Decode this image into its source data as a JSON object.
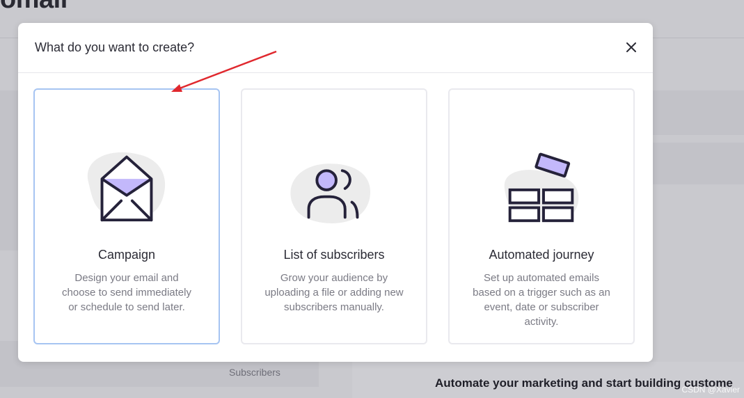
{
  "background": {
    "page_title_fragment": "omail",
    "subscribers_label": "Subscribers",
    "automate_text": "Automate your marketing and start building custome"
  },
  "modal": {
    "title": "What do you want to create?",
    "close_icon": "close-icon",
    "cards": [
      {
        "title": "Campaign",
        "description": "Design your email and choose to send immediately or schedule to send later.",
        "icon": "envelope-icon",
        "selected": true
      },
      {
        "title": "List of subscribers",
        "description": "Grow your audience by uploading a file or adding new subscribers manually.",
        "icon": "people-icon",
        "selected": false
      },
      {
        "title": "Automated journey",
        "description": "Set up automated emails based on a trigger such as an event, date or subscriber activity.",
        "icon": "workflow-blocks-icon",
        "selected": false
      }
    ]
  },
  "annotation": {
    "arrow_color": "#e0282e"
  },
  "watermark": "CSDN @Xavier",
  "colors": {
    "accent_purple": "#c3b8fb",
    "selected_border": "#a6c4f2",
    "blob_gray": "#ececec",
    "icon_stroke": "#25223a"
  }
}
